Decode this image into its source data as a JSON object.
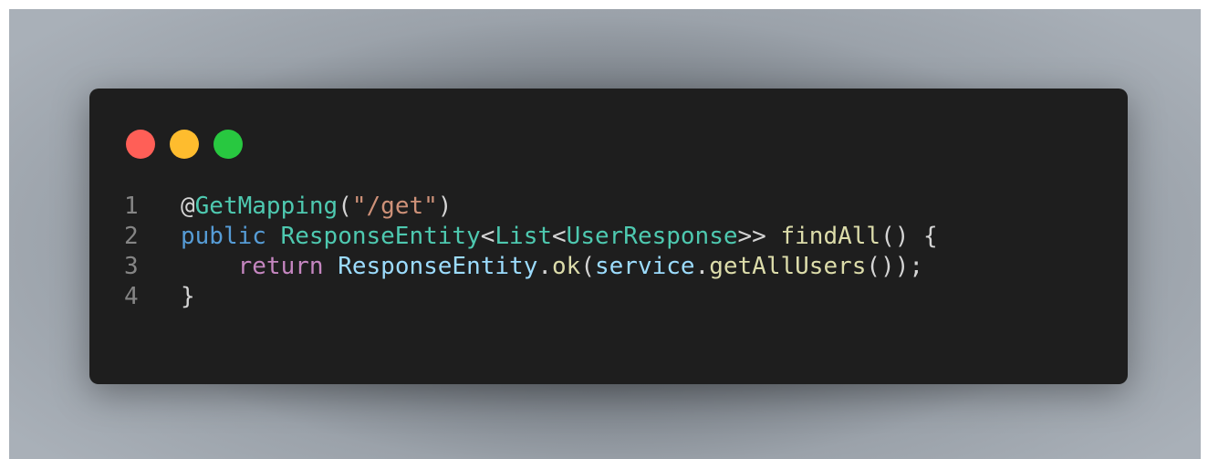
{
  "page": {
    "cutoff_text": "",
    "traffic_lights": {
      "colors": [
        "#ff5f57",
        "#febc2e",
        "#28c840"
      ]
    },
    "code_lines": [
      {
        "number": "1",
        "tokens": [
          {
            "text": "@",
            "color": "#d4d4d4"
          },
          {
            "text": "GetMapping",
            "color": "#4ec9b0"
          },
          {
            "text": "(",
            "color": "#d4d4d4"
          },
          {
            "text": "\"/get\"",
            "color": "#ce9178"
          },
          {
            "text": ")",
            "color": "#d4d4d4"
          }
        ]
      },
      {
        "number": "2",
        "tokens": [
          {
            "text": "public ",
            "color": "#569cd6"
          },
          {
            "text": "ResponseEntity",
            "color": "#4ec9b0"
          },
          {
            "text": "<",
            "color": "#d4d4d4"
          },
          {
            "text": "List",
            "color": "#4ec9b0"
          },
          {
            "text": "<",
            "color": "#d4d4d4"
          },
          {
            "text": "UserResponse",
            "color": "#4ec9b0"
          },
          {
            "text": ">> ",
            "color": "#d4d4d4"
          },
          {
            "text": "findAll",
            "color": "#dcdcaa"
          },
          {
            "text": "() {",
            "color": "#d4d4d4"
          }
        ]
      },
      {
        "number": "3",
        "tokens": [
          {
            "text": "    ",
            "color": "#d4d4d4"
          },
          {
            "text": "return ",
            "color": "#c586c0"
          },
          {
            "text": "ResponseEntity",
            "color": "#9cdcfe"
          },
          {
            "text": ".",
            "color": "#d4d4d4"
          },
          {
            "text": "ok",
            "color": "#dcdcaa"
          },
          {
            "text": "(",
            "color": "#d4d4d4"
          },
          {
            "text": "service",
            "color": "#9cdcfe"
          },
          {
            "text": ".",
            "color": "#d4d4d4"
          },
          {
            "text": "getAllUsers",
            "color": "#dcdcaa"
          },
          {
            "text": "());",
            "color": "#d4d4d4"
          }
        ]
      },
      {
        "number": "4",
        "tokens": [
          {
            "text": "}",
            "color": "#d4d4d4"
          }
        ]
      }
    ]
  }
}
